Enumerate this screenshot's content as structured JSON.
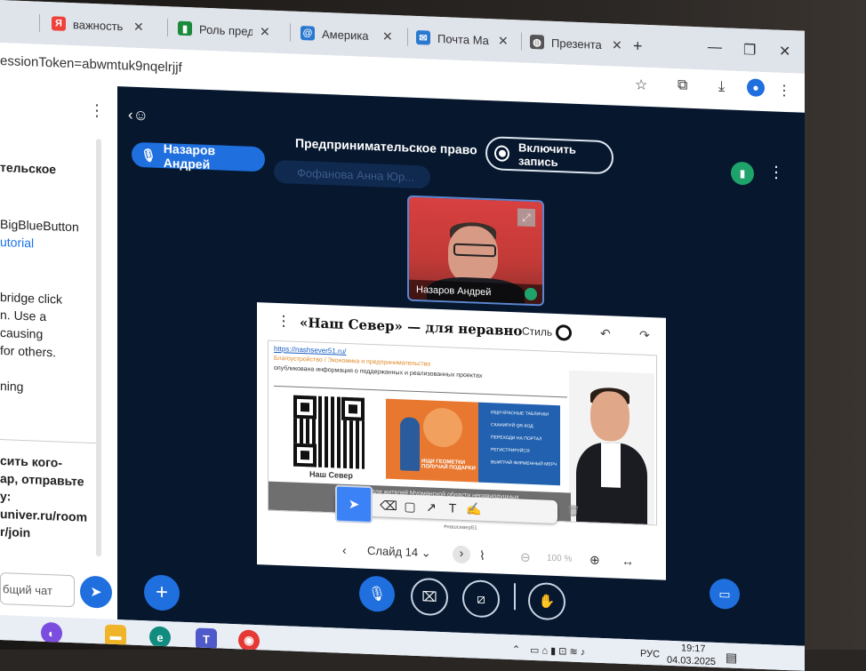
{
  "browser": {
    "tabs": [
      {
        "icon": "Я",
        "label": "важность",
        "icon_color": "#f0413a"
      },
      {
        "icon": "▮",
        "label": "Роль пред",
        "icon_color": "#1b8a3b"
      },
      {
        "icon": "@",
        "label": "Америка",
        "icon_color": "#2a78d0"
      },
      {
        "icon": "✉",
        "label": "Почта Ма",
        "icon_color": "#2a78d0"
      },
      {
        "icon": "◍",
        "label": "Презента",
        "icon_color": "#555555"
      }
    ],
    "new_tab": "+",
    "url": "essionToken=abwmtuk9nqelrjjf"
  },
  "chat_panel": {
    "lines": [
      {
        "text": "тельское",
        "bold": true
      },
      {
        "text": "BigBlueButton",
        "bold": false
      },
      {
        "text": "utorial",
        "link": true
      },
      {
        "text": "bridge click",
        "bold": false
      },
      {
        "text": "n. Use a",
        "bold": false
      },
      {
        "text": "causing",
        "bold": false
      },
      {
        "text": "for others.",
        "bold": false
      },
      {
        "text": "ning",
        "bold": false
      },
      {
        "text": "сить кого-",
        "bold": true
      },
      {
        "text": "ар, отправьте",
        "bold": true
      },
      {
        "text": "у:",
        "bold": true
      },
      {
        "text": "univer.ru/room",
        "bold": true
      },
      {
        "text": "r/join",
        "bold": true
      }
    ],
    "input_placeholder": "бщий чат"
  },
  "meeting": {
    "title": "Предпринимательское право",
    "record_label": "Включить запись",
    "talking": "Назаров Андрей",
    "participant_faded": "Фофанова Анна Юр...",
    "video_name": "Назаров Андрей"
  },
  "presentation": {
    "slide_heading": "«Наш Север» — для неравнодушных я",
    "style_label": "Стиль",
    "slide_link": "https://nashsever51.ru/",
    "slide_breadcrumb": "Благоустройство / Экономика и предпринимательство",
    "slide_desc": "опубликована информация о поддержанных и реализованных проектах",
    "qr_caption": "Наш Север",
    "orange_caption": "ИЩИ ГЕОМЕТКИ ПОЛУЧАЙ ПОДАРКИ",
    "blue_items": [
      "ИЩИ КРАСНЫЕ ТАБЛИЧКИ",
      "СКАНИРУЙ QR-КОД",
      "ПЕРЕХОДИ НА ПОРТАЛ",
      "РЕГИСТРИРУЙСЯ",
      "ВЫИГРАЙ ФИРМЕННЫЙ МЕРЧ"
    ],
    "footer_text": "Портал для жителей Мурманской области неравнодушных",
    "watermark": "#нашсевер51",
    "slide_label": "Слайд 14",
    "zoom": "100 %"
  },
  "taskbar": {
    "lang": "РУС",
    "time": "19:17",
    "date": "04.03.2025"
  }
}
